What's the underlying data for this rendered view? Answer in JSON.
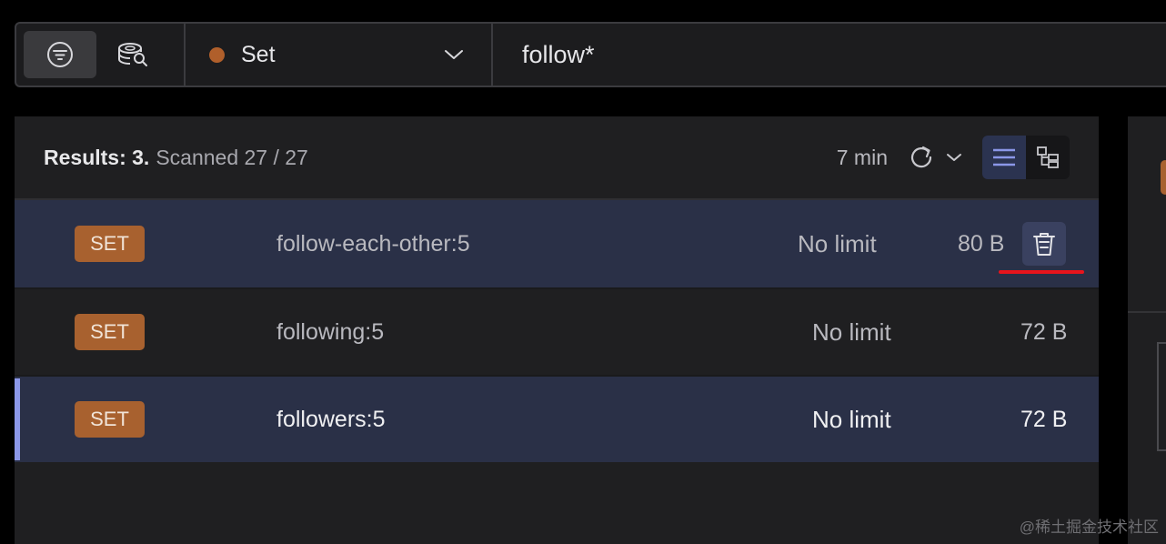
{
  "toolbar": {
    "modes": [
      {
        "icon": "filter-icon",
        "active": true
      },
      {
        "icon": "database-search-icon",
        "active": false
      }
    ],
    "type_filter": {
      "label": "Set",
      "color": "#b05f2b"
    },
    "search": {
      "value": "follow*",
      "placeholder": ""
    }
  },
  "results": {
    "count_label": "Results: 3.",
    "scanned_label": "Scanned 27 / 27",
    "refresh_time": "7 min",
    "view_modes": [
      "list-view-icon",
      "tree-view-icon"
    ],
    "active_view": "list"
  },
  "rows": [
    {
      "type": "SET",
      "key": "follow-each-other:5",
      "ttl": "No limit",
      "size": "80 B",
      "state": "hover"
    },
    {
      "type": "SET",
      "key": "following:5",
      "ttl": "No limit",
      "size": "72 B",
      "state": "normal"
    },
    {
      "type": "SET",
      "key": "followers:5",
      "ttl": "No limit",
      "size": "72 B",
      "state": "selected"
    }
  ],
  "watermark": "@稀土掘金技术社区",
  "colors": {
    "badge": "#a8612f",
    "selection": "#2a3047",
    "accent": "#8b97e8",
    "annotation": "#e8141c"
  }
}
